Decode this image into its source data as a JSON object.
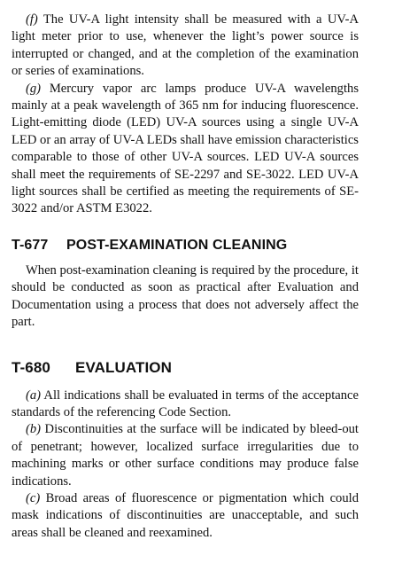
{
  "paragraphs_top": [
    {
      "marker": "(f)",
      "text": " The UV-A light intensity shall be measured with a UV-A light meter prior to use, whenever the light’s power source is interrupted or changed, and at the completion of the examination or series of examinations."
    },
    {
      "marker": "(g)",
      "text": " Mercury vapor arc lamps produce UV-A wave­lengths mainly at a peak wavelength of 365 nm for induc­ing fluorescence. Light-emitting diode (LED) UV-A sources using a single UV-A LED or an array of UV-A LEDs shall have emission characteristics comparable to those of other UV-A sources. LED UV-A sources shall meet the re­quirements of SE-2297 and SE-3022. LED UV-A light sources shall be certified as meeting the requirements of SE-3022 and/or ASTM E3022."
    }
  ],
  "section_t677": {
    "number": "T-677",
    "title": "POST-EXAMINATION CLEANING",
    "body": "When post-examination cleaning is required by the procedure, it should be conducted as soon as practical after Evaluation and Documentation using a process that does not adversely affect the part."
  },
  "section_t680": {
    "number": "T-680",
    "title": "EVALUATION",
    "items": [
      {
        "marker": "(a)",
        "text": " All indications shall be evaluated in terms of the ac­ceptance standards of the referencing Code Section."
      },
      {
        "marker": "(b)",
        "text": " Discontinuities at the surface will be indicated by bleed-out of penetrant; however, localized surface irregu­larities due to machining marks or other surface condi­tions may produce false indications."
      },
      {
        "marker": "(c)",
        "text": " Broad areas of fluorescence or pigmentation which could mask indications of discontinuities are unaccepta­ble, and such areas shall be cleaned and reexamined."
      }
    ]
  }
}
